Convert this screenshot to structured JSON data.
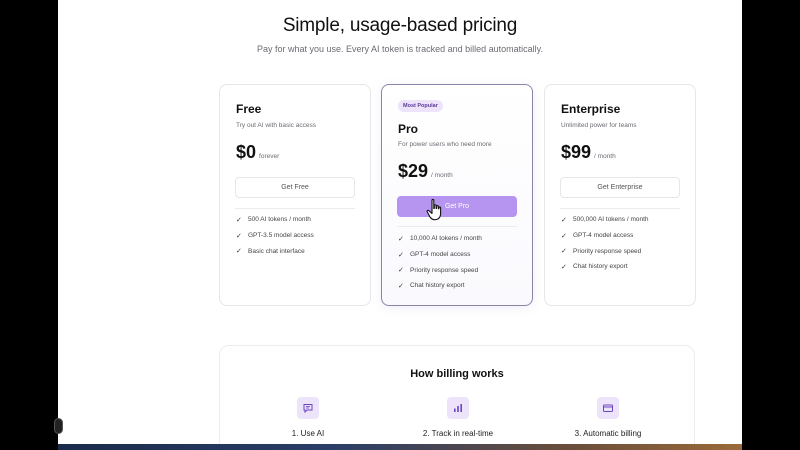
{
  "header": {
    "title": "Simple, usage-based pricing",
    "subtitle": "Pay for what you use. Every AI token is tracked and billed automatically."
  },
  "plans": [
    {
      "name": "Free",
      "description": "Try out AI with basic access",
      "price": "$0",
      "period": "forever",
      "cta": "Get Free",
      "features": [
        "500 AI tokens / month",
        "GPT-3.5 model access",
        "Basic chat interface"
      ]
    },
    {
      "badge": "Most Popular",
      "name": "Pro",
      "description": "For power users who need more",
      "price": "$29",
      "period": "/ month",
      "cta": "Get Pro",
      "features": [
        "10,000 AI tokens / month",
        "GPT-4 model access",
        "Priority response speed",
        "Chat history export"
      ]
    },
    {
      "name": "Enterprise",
      "description": "Unlimited power for teams",
      "price": "$99",
      "period": "/ month",
      "cta": "Get Enterprise",
      "features": [
        "500,000 AI tokens / month",
        "GPT-4 model access",
        "Priority response speed",
        "Chat history export"
      ]
    }
  ],
  "billing": {
    "title": "How billing works",
    "steps": [
      {
        "label": "1. Use AI",
        "icon": "chat-icon"
      },
      {
        "label": "2. Track in real-time",
        "icon": "bar-chart-icon"
      },
      {
        "label": "3. Automatic billing",
        "icon": "credit-card-icon"
      }
    ]
  },
  "icons": {
    "check": "check-icon",
    "cursor": "hand-pointer-icon"
  },
  "colors": {
    "accent": "#b595ef",
    "badge_bg": "#ede4fb",
    "badge_text": "#5a3a96",
    "pro_border": "#8c84a8"
  },
  "check_glyph": "✓"
}
